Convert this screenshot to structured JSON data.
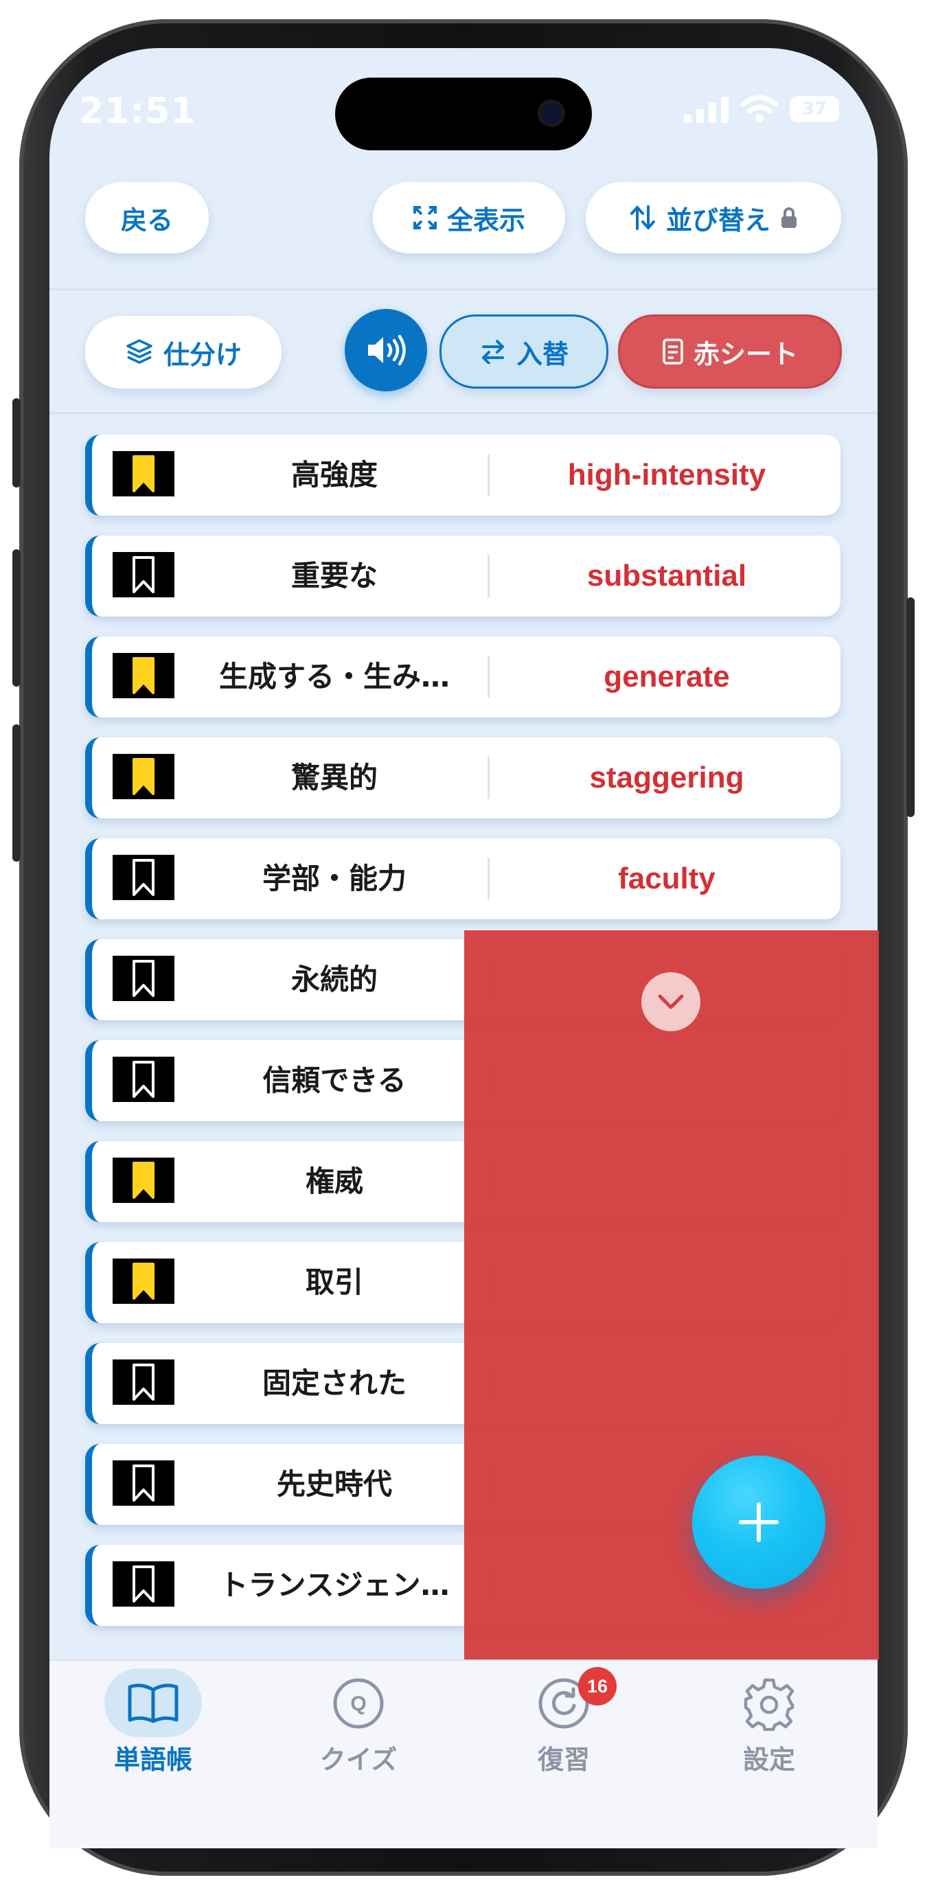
{
  "status": {
    "time": "21:51",
    "battery": "37"
  },
  "toolbar": {
    "back_label": "戻る",
    "fullscreen_label": "全表示",
    "sort_label": "並び替え",
    "sort_icon": "arrows-updown-icon",
    "lock_icon": "lock-icon"
  },
  "actions": {
    "sort_filter_label": "仕分け",
    "audio_icon": "speaker-icon",
    "swap_label": "入替",
    "redsheet_label": "赤シート",
    "redsheet_color": "#d9555a"
  },
  "words": [
    {
      "ja": "高強度",
      "en": "high-intensity",
      "bookmarked": true
    },
    {
      "ja": "重要な",
      "en": "substantial",
      "bookmarked": false
    },
    {
      "ja": "生成する・生み…",
      "en": "generate",
      "bookmarked": true
    },
    {
      "ja": "驚異的",
      "en": "staggering",
      "bookmarked": true
    },
    {
      "ja": "学部・能力",
      "en": "faculty",
      "bookmarked": false
    },
    {
      "ja": "永続的",
      "en": "",
      "bookmarked": false
    },
    {
      "ja": "信頼できる",
      "en": "",
      "bookmarked": false
    },
    {
      "ja": "権威",
      "en": "",
      "bookmarked": true
    },
    {
      "ja": "取引",
      "en": "",
      "bookmarked": true
    },
    {
      "ja": "固定された",
      "en": "",
      "bookmarked": false
    },
    {
      "ja": "先史時代",
      "en": "",
      "bookmarked": false
    },
    {
      "ja": "トランスジェン…",
      "en": "",
      "bookmarked": false
    }
  ],
  "colors": {
    "accent": "#0a74c4",
    "english_text": "#d42f35",
    "bookmark_fill": "#ffd21f",
    "red_sheet": "#d33d40",
    "fab": "#19c3f5"
  },
  "tabs": [
    {
      "label": "単語帳",
      "icon": "book-icon",
      "active": true
    },
    {
      "label": "クイズ",
      "icon": "quiz-icon",
      "active": false
    },
    {
      "label": "復習",
      "icon": "review-icon",
      "active": false,
      "badge": "16"
    },
    {
      "label": "設定",
      "icon": "gear-icon",
      "active": false
    }
  ]
}
